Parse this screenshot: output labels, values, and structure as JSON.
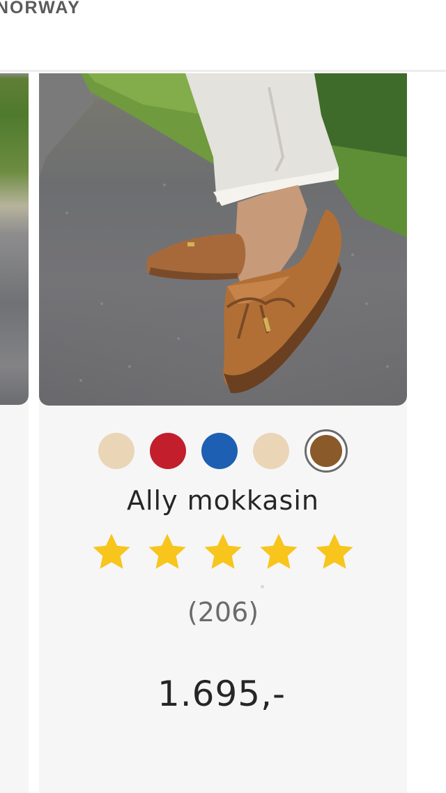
{
  "header": {
    "brand": "NORWAY"
  },
  "product": {
    "name": "Ally mokkasin",
    "rating": 5,
    "rating_max": 5,
    "review_count": "(206)",
    "price": "1.695,-",
    "swatches": [
      {
        "name": "beige",
        "color": "#ead5b6",
        "selected": false
      },
      {
        "name": "red",
        "color": "#c21e2b",
        "selected": false
      },
      {
        "name": "blue",
        "color": "#1d5fb3",
        "selected": false
      },
      {
        "name": "light-beige",
        "color": "#ead5b6",
        "selected": false
      },
      {
        "name": "brown",
        "color": "#8a5a2b",
        "selected": true
      }
    ]
  },
  "colors": {
    "star": "#f7c51c",
    "card_bg": "#f6f6f7"
  }
}
